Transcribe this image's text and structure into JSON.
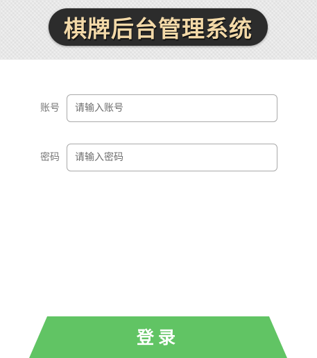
{
  "header": {
    "title": "棋牌后台管理系统"
  },
  "form": {
    "account": {
      "label": "账号",
      "placeholder": "请输入账号",
      "value": ""
    },
    "password": {
      "label": "密码",
      "placeholder": "请输入密码",
      "value": ""
    },
    "login_label": "登录"
  },
  "colors": {
    "title_bg": "#2c2c2c",
    "title_text": "#f3d9a8",
    "button_green": "#61c464",
    "input_border": "#a9a9a9",
    "label_gray": "#777777"
  }
}
